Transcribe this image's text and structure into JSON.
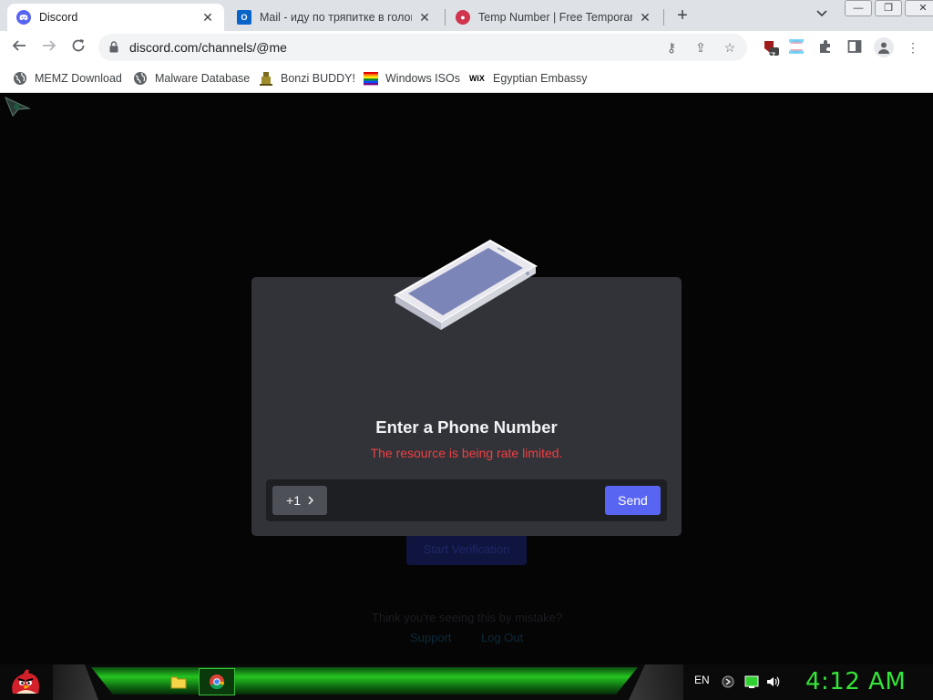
{
  "tabs": [
    {
      "title": "Discord",
      "favicon": "discord-icon",
      "active": true
    },
    {
      "title": "Mail - иду по тряпитке в голове",
      "favicon": "outlook-icon",
      "active": false
    },
    {
      "title": "Temp Number | Free Temporary Ph",
      "favicon": "temp-number-icon",
      "active": false
    }
  ],
  "address_bar": {
    "url": "discord.com/channels/@me"
  },
  "extensions": {
    "badge_count": "57"
  },
  "bookmarks": [
    {
      "label": "MEMZ Download",
      "icon": "globe-icon"
    },
    {
      "label": "Malware Database",
      "icon": "globe-icon"
    },
    {
      "label": "Bonzi BUDDY!",
      "icon": "bonzi-icon"
    },
    {
      "label": "Windows ISOs",
      "icon": "rainbow-flag-icon"
    },
    {
      "label": "Egyptian Embassy",
      "icon": "wix-icon"
    }
  ],
  "modal": {
    "title": "Enter a Phone Number",
    "error": "The resource is being rate limited.",
    "country_code": "+1",
    "phone_placeholder": "",
    "send_label": "Send"
  },
  "background": {
    "button_label": "Start Verification",
    "prompt": "Think you're seeing this by mistake?",
    "link_support": "Support",
    "link_logout": "Log Out"
  },
  "taskbar": {
    "language": "EN",
    "clock": "4:12 AM"
  },
  "colors": {
    "discord_blurple": "#5865f2",
    "error_red": "#f23f43",
    "modal_bg": "#313338",
    "clock_green": "#35e33a"
  }
}
